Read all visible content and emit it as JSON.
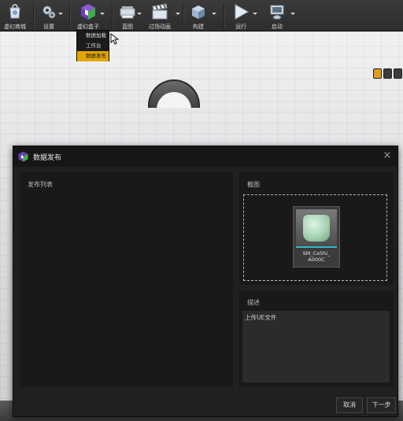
{
  "toolbar": {
    "items": [
      {
        "label": "虚幻商城",
        "icon": "marketplace-icon"
      },
      {
        "label": "设置",
        "icon": "settings-icon"
      },
      {
        "label": "虚幻盒子",
        "icon": "unreal-box-icon"
      },
      {
        "label": "蓝图",
        "icon": "blueprint-icon"
      },
      {
        "label": "过场动画",
        "icon": "cinematics-icon"
      },
      {
        "label": "构建",
        "icon": "build-icon"
      },
      {
        "label": "运行",
        "icon": "play-icon"
      },
      {
        "label": "启动",
        "icon": "launch-icon"
      }
    ]
  },
  "dropdown": {
    "items": [
      "数据加载",
      "工作台",
      "数据发布"
    ],
    "active_index": 2
  },
  "dialog": {
    "title": "数据发布",
    "close_symbol": "×",
    "publish_list_label": "发布列表",
    "screenshot_label": "截图",
    "asset_name_line1": "SM_CeShi_",
    "asset_name_line2": "A000C",
    "description_label": "描述",
    "description_text": "上传UE文件",
    "cancel_label": "取消",
    "next_label": "下一步"
  },
  "colors": {
    "accent": "#e2a600",
    "dialog_bg": "#202020",
    "panel_bg": "#191919",
    "thumb_bar": "#35b6c9"
  }
}
